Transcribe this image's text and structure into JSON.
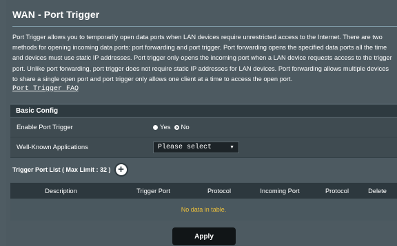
{
  "page": {
    "title": "WAN - Port Trigger",
    "description": "Port Trigger allows you to temporarily open data ports when LAN devices require unrestricted access to the Internet. There are two methods for opening incoming data ports: port forwarding and port trigger. Port forwarding opens the specified data ports all the time and devices must use static IP addresses. Port trigger only opens the incoming port when a LAN device requests access to the trigger port. Unlike port forwarding, port trigger does not require static IP addresses for LAN devices. Port forwarding allows multiple devices to share a single open port and port trigger only allows one client at a time to access the open port.",
    "faq_link": "Port Trigger FAQ"
  },
  "basic_config": {
    "header": "Basic Config",
    "enable": {
      "label": "Enable Port Trigger",
      "options": [
        "Yes",
        "No"
      ],
      "selected": "Yes"
    },
    "apps": {
      "label": "Well-Known Applications",
      "value": "Please select"
    }
  },
  "trigger_list": {
    "label": "Trigger Port List ( Max Limit : 32 )",
    "columns": [
      "Description",
      "Trigger Port",
      "Protocol",
      "Incoming Port",
      "Protocol",
      "Delete"
    ],
    "empty_text": "No data in table."
  },
  "apply_label": "Apply",
  "colors": {
    "background": "#4d5a61",
    "header": "#2e3a40",
    "empty_text": "#f0c23a",
    "button": "#111517"
  }
}
